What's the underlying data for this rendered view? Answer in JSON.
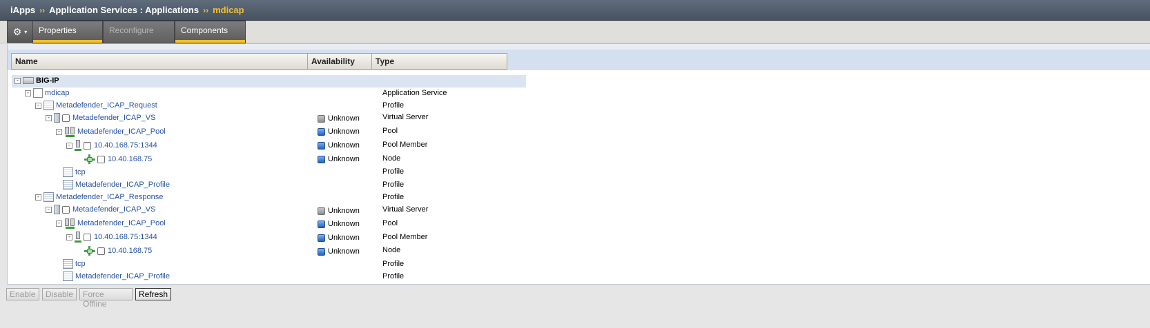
{
  "breadcrumb": {
    "items": [
      "iApps",
      "Application Services : Applications"
    ],
    "current": "mdicap",
    "separator": "››"
  },
  "toolbar": {
    "gear_icon": "gear-icon",
    "caret": "▾",
    "tabs": [
      {
        "label": "Properties",
        "state": "active"
      },
      {
        "label": "Reconfigure",
        "state": "disabled"
      },
      {
        "label": "Components",
        "state": "active"
      }
    ]
  },
  "table": {
    "columns": [
      "Name",
      "Availability",
      "Type"
    ],
    "root": "BIG-IP",
    "rows": [
      {
        "name": "mdicap",
        "availability": "",
        "status": "",
        "type": "Application Service"
      },
      {
        "name": "Metadefender_ICAP_Request",
        "availability": "",
        "status": "",
        "type": "Profile"
      },
      {
        "name": "Metadefender_ICAP_VS",
        "availability": "Unknown",
        "status": "grey",
        "type": "Virtual Server"
      },
      {
        "name": "Metadefender_ICAP_Pool",
        "availability": "Unknown",
        "status": "blue",
        "type": "Pool"
      },
      {
        "name": "10.40.168.75:1344",
        "availability": "Unknown",
        "status": "blue",
        "type": "Pool Member"
      },
      {
        "name": "10.40.168.75",
        "availability": "Unknown",
        "status": "blue",
        "type": "Node"
      },
      {
        "name": "tcp",
        "availability": "",
        "status": "",
        "type": "Profile"
      },
      {
        "name": "Metadefender_ICAP_Profile",
        "availability": "",
        "status": "",
        "type": "Profile"
      },
      {
        "name": "Metadefender_ICAP_Response",
        "availability": "",
        "status": "",
        "type": "Profile"
      },
      {
        "name": "Metadefender_ICAP_VS",
        "availability": "Unknown",
        "status": "grey",
        "type": "Virtual Server"
      },
      {
        "name": "Metadefender_ICAP_Pool",
        "availability": "Unknown",
        "status": "blue",
        "type": "Pool"
      },
      {
        "name": "10.40.168.75:1344",
        "availability": "Unknown",
        "status": "blue",
        "type": "Pool Member"
      },
      {
        "name": "10.40.168.75",
        "availability": "Unknown",
        "status": "blue",
        "type": "Node"
      },
      {
        "name": "tcp",
        "availability": "",
        "status": "",
        "type": "Profile"
      },
      {
        "name": "Metadefender_ICAP_Profile",
        "availability": "",
        "status": "",
        "type": "Profile"
      }
    ]
  },
  "actions": {
    "enable": "Enable",
    "disable": "Disable",
    "force_offline": "Force Offline",
    "refresh": "Refresh"
  },
  "colors": {
    "accent": "#f2c028",
    "link": "#2653a1",
    "status_unknown_blue": "#2762b7",
    "status_unknown_grey": "#8c8c8c"
  }
}
